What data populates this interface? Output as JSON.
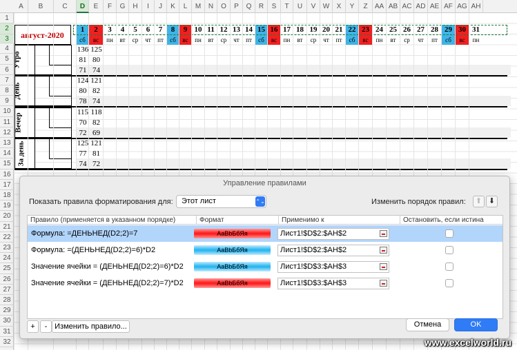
{
  "columns": [
    "A",
    "B",
    "C",
    "D",
    "E",
    "F",
    "G",
    "H",
    "I",
    "J",
    "K",
    "L",
    "M",
    "N",
    "O",
    "P",
    "Q",
    "R",
    "S",
    "T",
    "U",
    "V",
    "W",
    "X",
    "Y",
    "Z",
    "AA",
    "AB",
    "AC",
    "AD",
    "AE",
    "AF",
    "AG",
    "AH"
  ],
  "rows": [
    "1",
    "2",
    "3",
    "4",
    "5",
    "6",
    "7",
    "8",
    "9",
    "10",
    "11",
    "12",
    "13",
    "14",
    "15",
    "16",
    "17",
    "18",
    "19",
    "20",
    "21",
    "22",
    "23",
    "24",
    "25",
    "26",
    "27",
    "28",
    "29",
    "30",
    "31",
    "32"
  ],
  "month_title": "август-2020",
  "days": [
    "1",
    "2",
    "3",
    "4",
    "5",
    "6",
    "7",
    "8",
    "9",
    "10",
    "11",
    "12",
    "13",
    "14",
    "15",
    "16",
    "17",
    "18",
    "19",
    "20",
    "21",
    "22",
    "23",
    "24",
    "25",
    "26",
    "27",
    "28",
    "29",
    "30",
    "31"
  ],
  "weekdays": [
    "сб",
    "вс",
    "пн",
    "вт",
    "ср",
    "чт",
    "пт",
    "сб",
    "вс",
    "пн",
    "вт",
    "ср",
    "чт",
    "пт",
    "сб",
    "вс",
    "пн",
    "вт",
    "ср",
    "чт",
    "пт",
    "сб",
    "вс",
    "пн",
    "вт",
    "ср",
    "чт",
    "пт",
    "сб",
    "вс",
    "пн"
  ],
  "sections": [
    {
      "label": "Утро",
      "d": [
        "136",
        "81",
        "71"
      ],
      "e": [
        "125",
        "80",
        "74"
      ]
    },
    {
      "label": "День",
      "d": [
        "124",
        "80",
        "78"
      ],
      "e": [
        "121",
        "82",
        "74"
      ]
    },
    {
      "label": "Вечер",
      "d": [
        "115",
        "70",
        "72"
      ],
      "e": [
        "118",
        "82",
        "69"
      ]
    },
    {
      "label": "За день",
      "d": [
        "125",
        "77",
        "74"
      ],
      "e": [
        "121",
        "81",
        "72"
      ]
    }
  ],
  "dialog": {
    "title": "Управление правилами",
    "show_rules_label": "Показать правила форматирования для:",
    "scope_value": "Этот лист",
    "reorder_label": "Изменить порядок правил:",
    "headers": {
      "rule": "Правило (применяется в указанном порядке)",
      "format": "Формат",
      "applies": "Применимо к",
      "stop": "Остановить, если истина"
    },
    "rules": [
      {
        "rule": "Формула: =ДЕНЬНЕД(D2;2)=7",
        "format_sample": "АаВbБбЯя",
        "color": "red",
        "applies": "Лист1!$D$2:$AH$2"
      },
      {
        "rule": "Формула: =(ДЕНЬНЕД(D2;2)=6)*D2",
        "format_sample": "AaBbБбЯя",
        "color": "blue",
        "applies": "Лист1!$D$2:$AH$2"
      },
      {
        "rule": "Значение ячейки = (ДЕНЬНЕД(D2;2)=6)*D2",
        "format_sample": "AaBbБбЯя",
        "color": "blue",
        "applies": "Лист1!$D$3:$AH$3"
      },
      {
        "rule": "Значение ячейки = (ДЕНЬНЕД(D2;2)=7)*D2",
        "format_sample": "АаВbБбЯя",
        "color": "red",
        "applies": "Лист1!$D$3:$AH$3"
      }
    ],
    "add_label": "+",
    "remove_label": "-",
    "edit_label": "Изменить правило...",
    "cancel_label": "Отмена",
    "ok_label": "OK"
  },
  "watermark": "www.excelworld.ru",
  "colors": {
    "accent": "#2f7cf6",
    "weekend_red": "#f02020",
    "weekend_blue": "#3fb4e6",
    "title_red": "#c00000"
  }
}
